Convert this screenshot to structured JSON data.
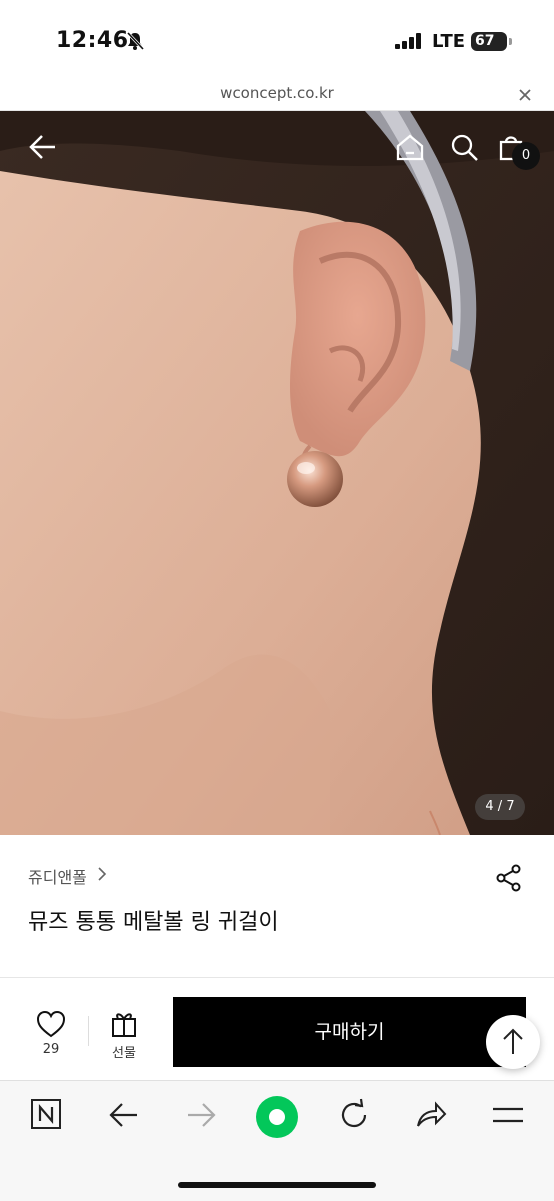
{
  "status_bar": {
    "time": "12:46",
    "network": "LTE",
    "battery": "67"
  },
  "browser": {
    "url": "wconcept.co.kr"
  },
  "gallery": {
    "counter": "4 / 7",
    "cart_count": "0"
  },
  "product": {
    "brand": "쥬디앤폴",
    "title": "뮤즈 통통 메탈볼 링 귀걸이"
  },
  "actions": {
    "like_count": "29",
    "gift_label": "선물",
    "buy_label": "구매하기"
  },
  "colors": {
    "buy_bg": "#000000",
    "naver_green": "#03c75a"
  },
  "icons": [
    "back-arrow-icon",
    "home-icon",
    "search-icon",
    "cart-icon",
    "share-icon",
    "heart-icon",
    "gift-icon",
    "arrow-up-icon",
    "naver-icon",
    "refresh-icon",
    "hamburger-icon"
  ]
}
